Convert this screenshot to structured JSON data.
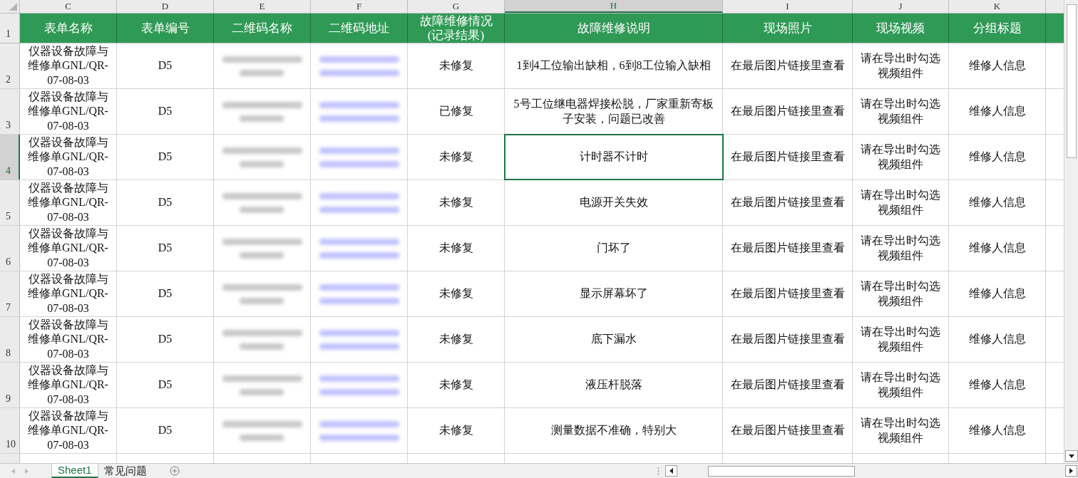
{
  "columns": [
    {
      "letter": "C",
      "title": "表单名称",
      "kind": "text",
      "selected": false
    },
    {
      "letter": "D",
      "title": "表单编号",
      "kind": "text",
      "selected": false
    },
    {
      "letter": "E",
      "title": "二维码名称",
      "kind": "blurred",
      "selected": false
    },
    {
      "letter": "F",
      "title": "二维码地址",
      "kind": "blurred_link",
      "selected": false
    },
    {
      "letter": "G",
      "title": "故障维修情况\n(记录结果)",
      "kind": "text",
      "selected": false
    },
    {
      "letter": "H",
      "title": "故障维修说明",
      "kind": "text",
      "selected": true
    },
    {
      "letter": "I",
      "title": "现场照片",
      "kind": "text",
      "selected": false
    },
    {
      "letter": "J",
      "title": "现场视频",
      "kind": "text",
      "selected": false
    },
    {
      "letter": "K",
      "title": "分组标题",
      "kind": "text",
      "selected": false
    }
  ],
  "header_row_number": "1",
  "rows": [
    {
      "number": "2",
      "selected": false,
      "cells": [
        "仪器设备故障与维修单GNL/QR-07-08-03",
        "D5",
        "未修复",
        "1到4工位输出缺相，6到8工位输入缺相",
        "在最后图片链接里查看",
        "请在导出时勾选视频组件",
        "维修人信息"
      ]
    },
    {
      "number": "3",
      "selected": false,
      "cells": [
        "仪器设备故障与维修单GNL/QR-07-08-03",
        "D5",
        "已修复",
        "5号工位继电器焊接松脱，厂家重新寄板子安装，问题已改善",
        "在最后图片链接里查看",
        "请在导出时勾选视频组件",
        "维修人信息"
      ]
    },
    {
      "number": "4",
      "selected": true,
      "cells": [
        "仪器设备故障与维修单GNL/QR-07-08-03",
        "D5",
        "未修复",
        "计时器不计时",
        "在最后图片链接里查看",
        "请在导出时勾选视频组件",
        "维修人信息"
      ]
    },
    {
      "number": "5",
      "selected": false,
      "cells": [
        "仪器设备故障与维修单GNL/QR-07-08-03",
        "D5",
        "未修复",
        "电源开关失效",
        "在最后图片链接里查看",
        "请在导出时勾选视频组件",
        "维修人信息"
      ]
    },
    {
      "number": "6",
      "selected": false,
      "cells": [
        "仪器设备故障与维修单GNL/QR-07-08-03",
        "D5",
        "未修复",
        "门坏了",
        "在最后图片链接里查看",
        "请在导出时勾选视频组件",
        "维修人信息"
      ]
    },
    {
      "number": "7",
      "selected": false,
      "cells": [
        "仪器设备故障与维修单GNL/QR-07-08-03",
        "D5",
        "未修复",
        "显示屏幕坏了",
        "在最后图片链接里查看",
        "请在导出时勾选视频组件",
        "维修人信息"
      ]
    },
    {
      "number": "8",
      "selected": false,
      "cells": [
        "仪器设备故障与维修单GNL/QR-07-08-03",
        "D5",
        "未修复",
        "底下漏水",
        "在最后图片链接里查看",
        "请在导出时勾选视频组件",
        "维修人信息"
      ]
    },
    {
      "number": "9",
      "selected": false,
      "cells": [
        "仪器设备故障与维修单GNL/QR-07-08-03",
        "D5",
        "未修复",
        "液压杆脱落",
        "在最后图片链接里查看",
        "请在导出时勾选视频组件",
        "维修人信息"
      ]
    },
    {
      "number": "10",
      "selected": false,
      "cells": [
        "仪器设备故障与维修单GNL/QR-07-08-03",
        "D5",
        "未修复",
        "测量数据不准确，特别大",
        "在最后图片链接里查看",
        "请在导出时勾选视频组件",
        "维修人信息"
      ]
    }
  ],
  "sheet_tabs": [
    {
      "label": "Sheet1",
      "selected": true
    },
    {
      "label": "常见问题",
      "selected": false
    }
  ]
}
